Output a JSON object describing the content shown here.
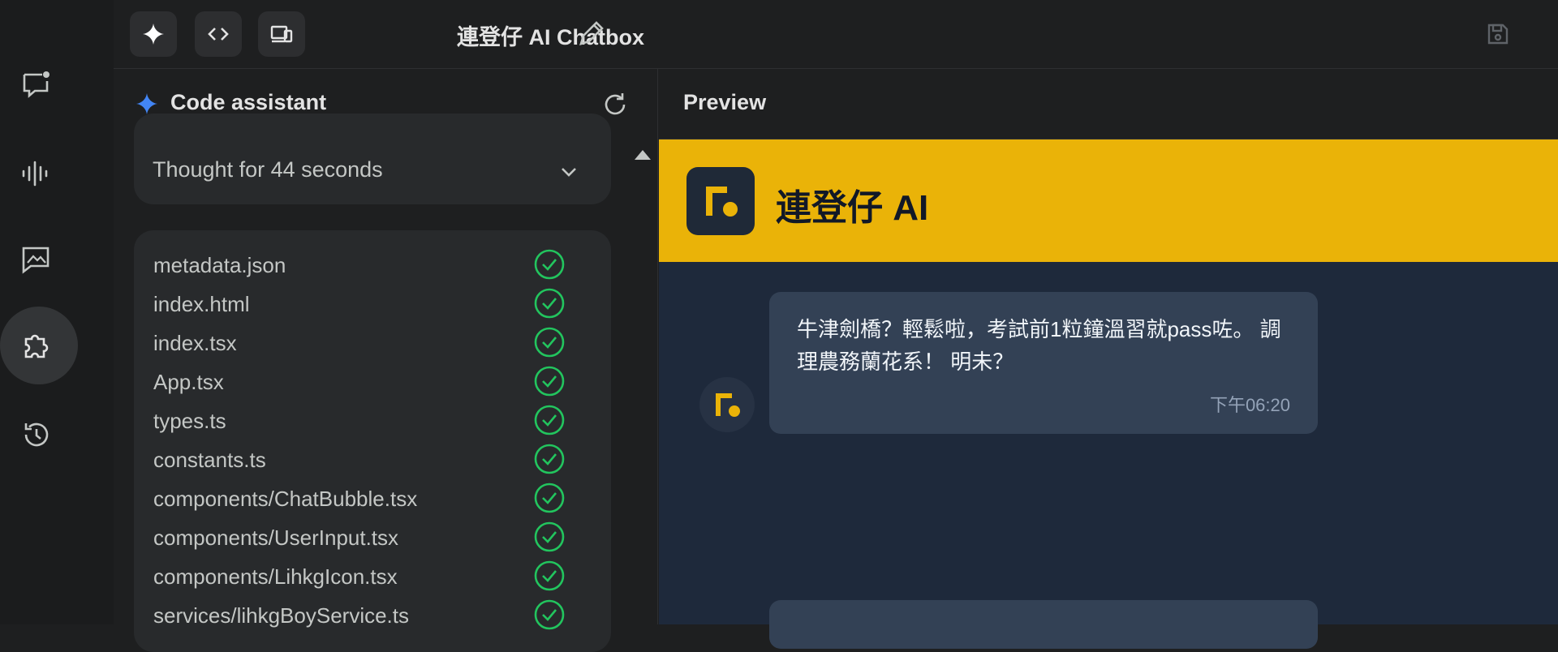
{
  "header": {
    "title": "連登仔 AI Chatbox"
  },
  "assistant": {
    "title": "Code assistant",
    "thought": "Thought for 44 seconds",
    "files": [
      "metadata.json",
      "index.html",
      "index.tsx",
      "App.tsx",
      "types.ts",
      "constants.ts",
      "components/ChatBubble.tsx",
      "components/UserInput.tsx",
      "components/LihkgIcon.tsx",
      "services/lihkgBoyService.ts"
    ]
  },
  "preview": {
    "title": "Preview",
    "brand": "連登仔 AI",
    "message": {
      "text": "牛津劍橋？輕鬆啦，考試前1粒鐘溫習就pass咗。 調理農務蘭花系！ 明未？",
      "time": "下午06:20"
    }
  },
  "colors": {
    "accent": "#eab308",
    "check": "#22c55e",
    "sparkle": "#4285f4"
  }
}
